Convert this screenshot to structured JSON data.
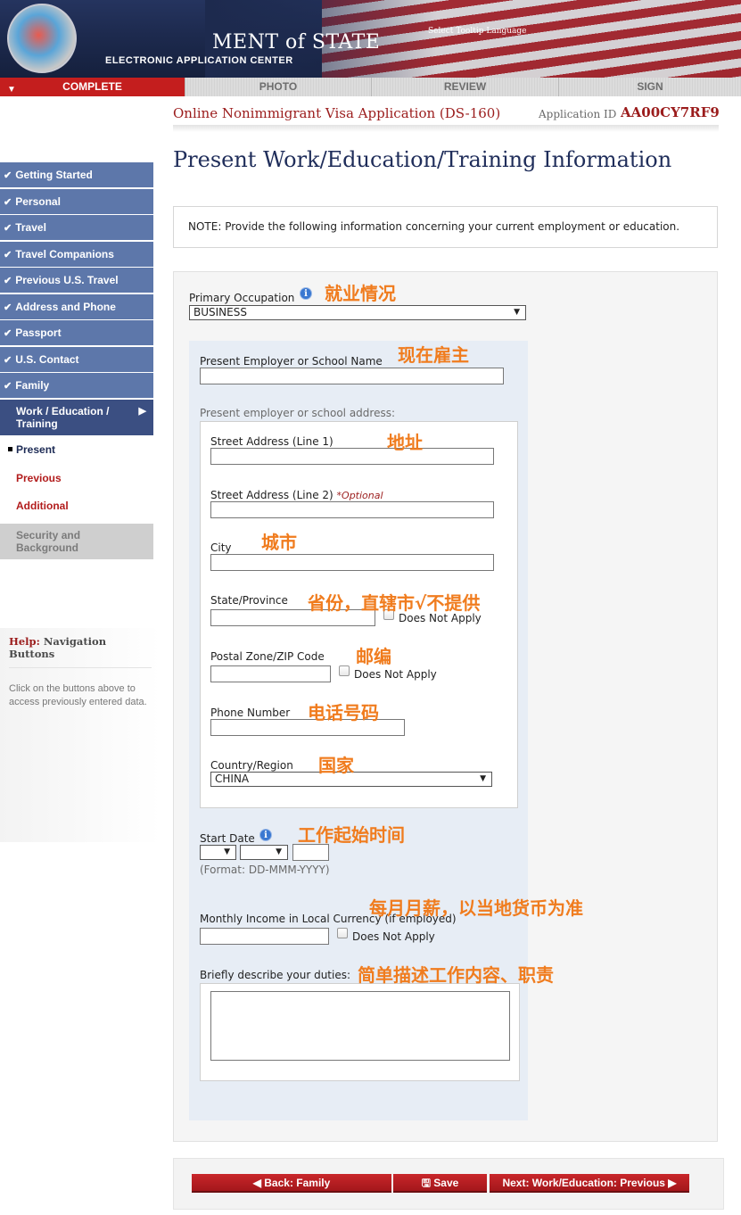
{
  "header": {
    "title": "MENT of STATE",
    "subtitle": "ELECTRONIC APPLICATION CENTER",
    "tooltip_language": "Select Tooltip Language"
  },
  "tabs": [
    {
      "label": "COMPLETE",
      "active": true
    },
    {
      "label": "PHOTO",
      "active": false
    },
    {
      "label": "REVIEW",
      "active": false
    },
    {
      "label": "SIGN",
      "active": false
    }
  ],
  "application": {
    "title": "Online Nonimmigrant Visa Application (DS-160)",
    "id_label": "Application ID",
    "id": "AA00CY7RF9"
  },
  "sidebar": {
    "items": [
      {
        "label": "Getting Started"
      },
      {
        "label": "Personal"
      },
      {
        "label": "Travel"
      },
      {
        "label": "Travel Companions"
      },
      {
        "label": "Previous U.S. Travel"
      },
      {
        "label": "Address and Phone"
      },
      {
        "label": "Passport"
      },
      {
        "label": "U.S. Contact"
      },
      {
        "label": "Family"
      }
    ],
    "current": {
      "label_line1": "Work / Education /",
      "label_line2": "Training"
    },
    "subitems": [
      {
        "label": "Present"
      },
      {
        "label": "Previous"
      },
      {
        "label": "Additional"
      }
    ],
    "future": {
      "label_line1": "Security and",
      "label_line2": "Background"
    }
  },
  "help": {
    "title_prefix": "Help:",
    "title": "Navigation Buttons",
    "text": "Click on the buttons above to access previously entered data."
  },
  "page": {
    "title": "Present Work/Education/Training Information",
    "note": "NOTE: Provide the following information concerning your current employment or education."
  },
  "form": {
    "primary_occupation": {
      "label": "Primary Occupation",
      "value": "BUSINESS"
    },
    "employer_name": {
      "label": "Present Employer or School Name",
      "value": ""
    },
    "address_heading": "Present employer or school address:",
    "street1": {
      "label": "Street Address (Line 1)",
      "value": ""
    },
    "street2": {
      "label": "Street Address (Line 2)",
      "optional": "*Optional",
      "value": ""
    },
    "city": {
      "label": "City",
      "value": ""
    },
    "state": {
      "label": "State/Province",
      "value": "",
      "dna": "Does Not Apply"
    },
    "postal": {
      "label": "Postal Zone/ZIP Code",
      "value": "",
      "dna": "Does Not Apply"
    },
    "phone": {
      "label": "Phone Number",
      "value": ""
    },
    "country": {
      "label": "Country/Region",
      "value": "CHINA"
    },
    "start_date": {
      "label": "Start Date",
      "format": "(Format: DD-MMM-YYYY)"
    },
    "income": {
      "label": "Monthly Income in Local Currency (if employed)",
      "value": "",
      "dna": "Does Not Apply"
    },
    "duties": {
      "label": "Briefly describe your duties:",
      "value": ""
    }
  },
  "annotations": {
    "occupation": "就业情况",
    "employer": "现在雇主",
    "address": "地址",
    "city": "城市",
    "state": "省份，直辖市√不提供",
    "postal": "邮编",
    "phone": "电话号码",
    "country": "国家",
    "start_date": "工作起始时间",
    "income": "每月月薪，以当地货币为准",
    "duties": "简单描述工作内容、职责"
  },
  "buttons": {
    "back": "Back: Family",
    "save": "Save",
    "next": "Next: Work/Education: Previous"
  },
  "colors": {
    "accent_red": "#c41e1e",
    "nav_blue": "#5d77aa",
    "annotation_orange": "#f07c1e"
  }
}
